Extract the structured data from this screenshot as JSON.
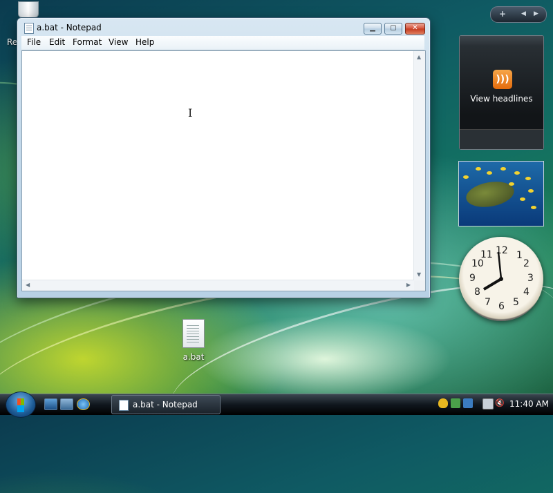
{
  "desktop": {
    "recycle_bin_label": "Re",
    "file_icon_label": "a.bat"
  },
  "window": {
    "title": "a.bat - Notepad",
    "menu": [
      "File",
      "Edit",
      "Format",
      "View",
      "Help"
    ],
    "content": ""
  },
  "gadgets": {
    "rss": {
      "label": "View headlines"
    },
    "clock": {
      "numbers": [
        "12",
        "1",
        "2",
        "3",
        "4",
        "5",
        "6",
        "7",
        "8",
        "9",
        "10",
        "11"
      ]
    }
  },
  "taskbar": {
    "active_task": "a.bat - Notepad",
    "time": "11:40 AM"
  },
  "colors": {
    "rss_orange": "#f08a24",
    "accent_blue": "#1c5a94",
    "close_red": "#d6523a"
  }
}
